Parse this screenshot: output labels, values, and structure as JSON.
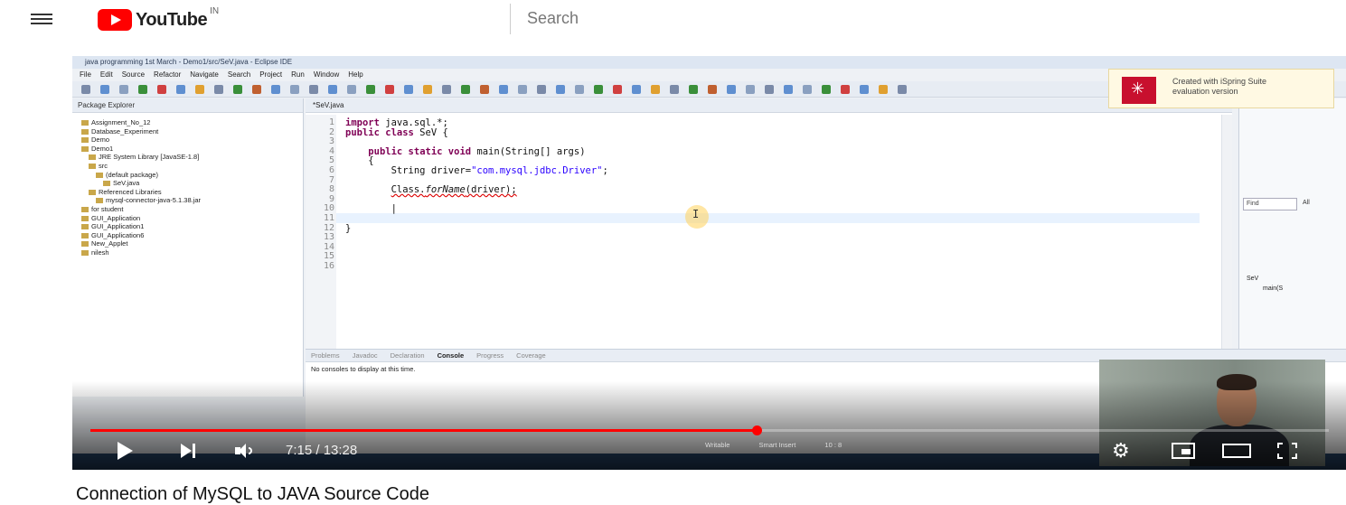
{
  "header": {
    "logo_text": "YouTube",
    "country": "IN",
    "search_placeholder": "Search"
  },
  "ide": {
    "window_title": "java programming 1st March - Demo1/src/SeV.java - Eclipse IDE",
    "menu": [
      "File",
      "Edit",
      "Source",
      "Refactor",
      "Navigate",
      "Search",
      "Project",
      "Run",
      "Window",
      "Help"
    ],
    "package_explorer": {
      "title": "Package Explorer",
      "items": [
        {
          "label": "Assignment_No_12",
          "indent": 0
        },
        {
          "label": "Database_Experiment",
          "indent": 0
        },
        {
          "label": "Demo",
          "indent": 0
        },
        {
          "label": "Demo1",
          "indent": 0
        },
        {
          "label": "JRE System Library [JavaSE-1.8]",
          "indent": 1
        },
        {
          "label": "src",
          "indent": 1
        },
        {
          "label": "(default package)",
          "indent": 2
        },
        {
          "label": "SeV.java",
          "indent": 3
        },
        {
          "label": "Referenced Libraries",
          "indent": 1
        },
        {
          "label": "mysql-connector-java-5.1.38.jar",
          "indent": 2
        },
        {
          "label": "for student",
          "indent": 0
        },
        {
          "label": "GUI_Application",
          "indent": 0
        },
        {
          "label": "GUI_Application1",
          "indent": 0
        },
        {
          "label": "GUI_Application6",
          "indent": 0
        },
        {
          "label": "New_Applet",
          "indent": 0
        },
        {
          "label": "nilesh",
          "indent": 0
        }
      ]
    },
    "editor_tab": "*SeV.java",
    "line_numbers": [
      "1",
      "2",
      "3",
      "4",
      "5",
      "6",
      "7",
      "8",
      "9",
      "10",
      "11",
      "12",
      "13",
      "14",
      "15",
      "16"
    ],
    "code": {
      "l1_kw": "import",
      "l1_rest": " java.sql.*;",
      "l2_kw": "public class",
      "l2_rest": " SeV {",
      "l4_kw": "public static void",
      "l4_rest": " main(String[] args)",
      "l5": "{",
      "l6_a": "String driver=",
      "l6_str": "\"com.mysql.jdbc.Driver\"",
      "l6_b": ";",
      "l8_a": "Class.",
      "l8_m": "forName",
      "l8_b": "(driver);",
      "l10": "|",
      "l13": "}",
      "l15": "}"
    },
    "right_panel": {
      "find_placeholder": "Find",
      "all_label": "All",
      "outline_class": "SeV",
      "outline_method": "main(S"
    },
    "console": {
      "tabs": [
        "Problems",
        "Javadoc",
        "Declaration",
        "Console",
        "Progress",
        "Coverage"
      ],
      "active_tab": "Console",
      "message": "No consoles to display at this time."
    },
    "status": {
      "writable": "Writable",
      "insert_mode": "Smart Insert",
      "position": "10 : 8"
    }
  },
  "watermark": {
    "line1": "Created with iSpring Suite",
    "line2": "evaluation version"
  },
  "player": {
    "current_time": "7:15",
    "duration": "13:28",
    "time_display": "7:15 / 13:28",
    "progress_fraction": 0.538
  },
  "video": {
    "title": "Connection of MySQL to JAVA Source Code"
  }
}
